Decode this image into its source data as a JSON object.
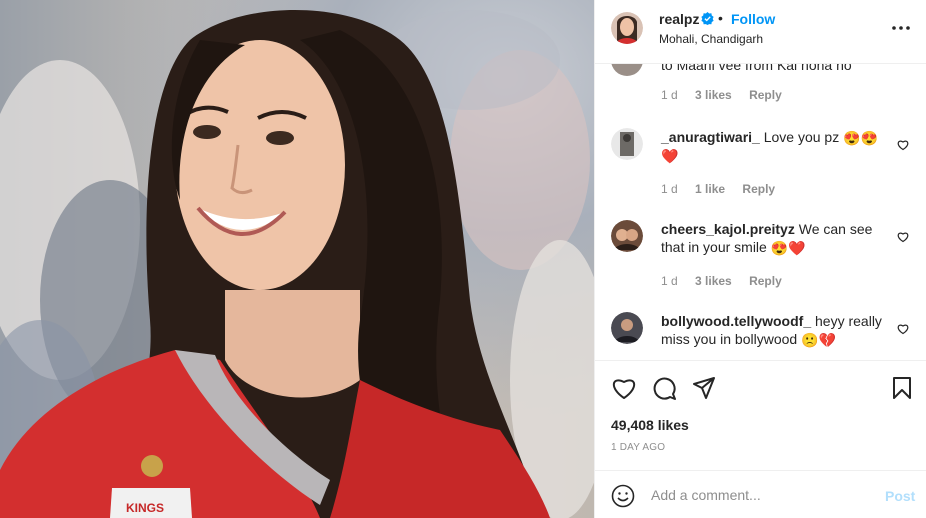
{
  "post": {
    "username": "realpz",
    "follow_label": "Follow",
    "location": "Mohali, Chandigarh",
    "jersey_text": "KINGS"
  },
  "comments": [
    {
      "username": "",
      "text": "to Maahi vee from Kal hona ho",
      "time": "1 d",
      "likes": "3 likes",
      "reply": "Reply"
    },
    {
      "username": "_anuragtiwari_",
      "text": "Love you pz",
      "emoji": [
        "😍",
        "😍",
        "❤️"
      ],
      "time": "1 d",
      "likes": "1 like",
      "reply": "Reply"
    },
    {
      "username": "cheers_kajol.preityz",
      "text": "We can see that in your smile",
      "emoji": [
        "😍",
        "❤️"
      ],
      "time": "1 d",
      "likes": "3 likes",
      "reply": "Reply"
    },
    {
      "username": "bollywood.tellywoodf_",
      "text": "heyy really miss you in bollywood",
      "emoji": [
        "🙁",
        "💔"
      ],
      "time": "",
      "likes": "",
      "reply": ""
    }
  ],
  "actions": {
    "icons": [
      "heart-icon",
      "comment-icon",
      "share-icon",
      "bookmark-icon"
    ],
    "likes_count": "49,408 likes",
    "posted_ago": "1 DAY AGO"
  },
  "add_comment": {
    "placeholder": "Add a comment...",
    "post_label": "Post"
  },
  "colors": {
    "link_blue": "#0095f6",
    "post_disabled": "#b2dffc",
    "muted": "#8e8e8e",
    "heart_red": "#ed4956",
    "jersey_red": "#d32f2f"
  }
}
